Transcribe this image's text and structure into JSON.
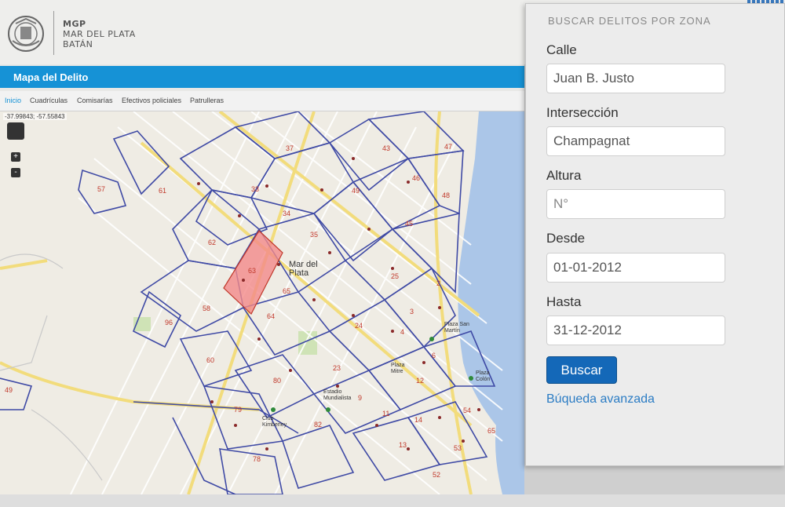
{
  "header": {
    "logo_icon": "city-seal-icon",
    "line1": "MGP",
    "line2": "MAR DEL PLATA",
    "line3": "BATÁN"
  },
  "titlebar": {
    "title": "Mapa del Delito"
  },
  "tabs": [
    {
      "label": "Inicio",
      "active": true
    },
    {
      "label": "Cuadrículas",
      "active": false
    },
    {
      "label": "Comisarías",
      "active": false
    },
    {
      "label": "Efectivos policiales",
      "active": false
    },
    {
      "label": "Patrulleras",
      "active": false
    }
  ],
  "map": {
    "coords": "-37.99843; -57.55843",
    "controls": {
      "pan_icon": "pan-arrows-icon",
      "zoom_in": "+",
      "zoom_out": "-"
    },
    "city_label": "Mar del\nPlata",
    "zone_labels": [
      "37",
      "43",
      "47",
      "57",
      "61",
      "33",
      "49",
      "46",
      "48",
      "34",
      "35",
      "45",
      "62",
      "63",
      "65",
      "64",
      "25",
      "2",
      "58",
      "60",
      "96",
      "24",
      "4",
      "6",
      "3",
      "12",
      "49",
      "79",
      "80",
      "82",
      "23",
      "11",
      "14",
      "13",
      "78",
      "53",
      "52",
      "54",
      "9",
      "65"
    ],
    "highlighted_zone": "63",
    "place_labels": [
      "Club Kimberley",
      "Estadio Mundialista",
      "Plaza San Martín",
      "Plaza Colón",
      "Plaza Mitre"
    ],
    "colors": {
      "land": "#efece4",
      "sea": "#abc6e8",
      "zone_border": "#3f4aa5",
      "highlight": "#f28a8a",
      "avenue": "#f6e59a"
    }
  },
  "panel": {
    "title": "BUSCAR DELITOS POR ZONA",
    "fields": [
      {
        "label": "Calle",
        "value": "Juan B. Justo",
        "placeholder": ""
      },
      {
        "label": "Intersección",
        "value": "Champagnat",
        "placeholder": ""
      },
      {
        "label": "Altura",
        "value": "",
        "placeholder": "N°"
      },
      {
        "label": "Desde",
        "value": "01-01-2012",
        "placeholder": ""
      },
      {
        "label": "Hasta",
        "value": "31-12-2012",
        "placeholder": ""
      }
    ],
    "search_button": "Buscar",
    "advanced_link": "Búqueda avanzada",
    "colors": {
      "button": "#1468b8",
      "link": "#2b7cc4"
    }
  }
}
